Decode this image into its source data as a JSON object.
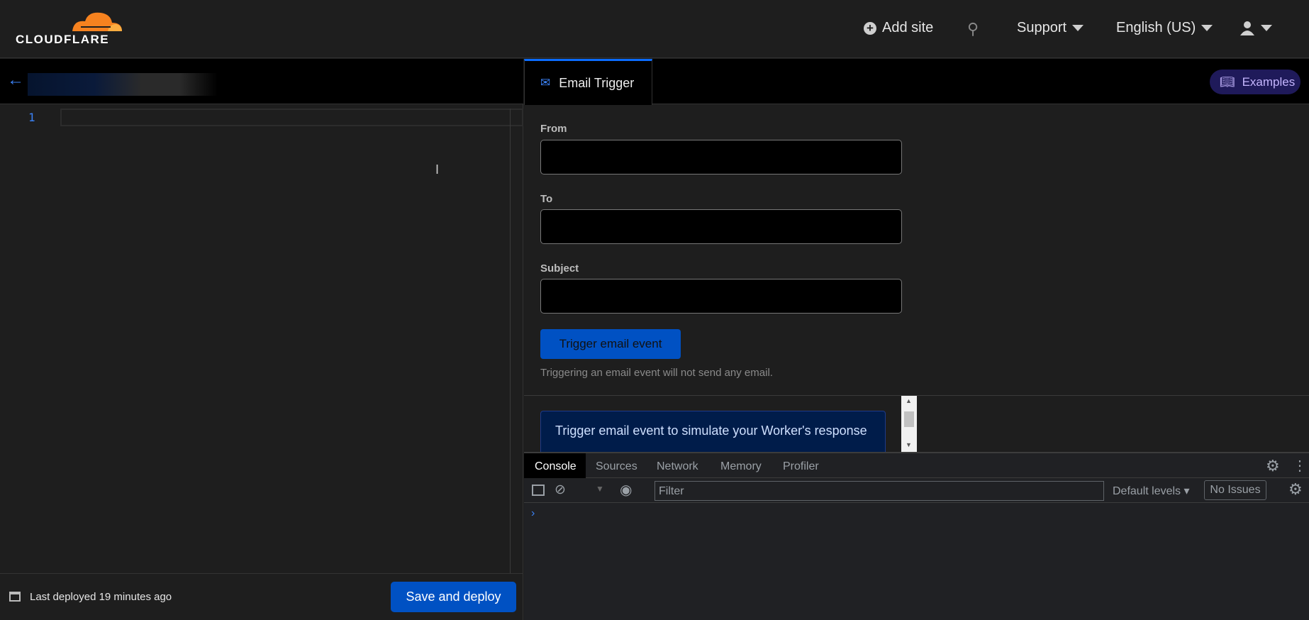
{
  "header": {
    "logo_text": "CLOUDFLARE",
    "add_site": "Add site",
    "support": "Support",
    "language": "English (US)"
  },
  "editor": {
    "line_numbers": [
      "1"
    ],
    "last_deployed": "Last deployed 19 minutes ago",
    "save_deploy": "Save and deploy"
  },
  "preview": {
    "tab_label": "Email Trigger",
    "examples_label": "Examples",
    "from_label": "From",
    "from_value": "",
    "to_label": "To",
    "to_value": "",
    "subject_label": "Subject",
    "subject_value": "",
    "trigger_button": "Trigger email event",
    "note": "Triggering an email event will not send any email.",
    "response_info": "Trigger email event to simulate your Worker's response"
  },
  "devtools": {
    "tabs": [
      "Console",
      "Sources",
      "Network",
      "Memory",
      "Profiler"
    ],
    "active_tab": "Console",
    "filter_placeholder": "Filter",
    "levels": "Default levels",
    "issues": "No Issues"
  },
  "colors": {
    "accent": "#0051c3",
    "brand_orange": "#f6821f",
    "link_blue": "#3b82f6"
  }
}
